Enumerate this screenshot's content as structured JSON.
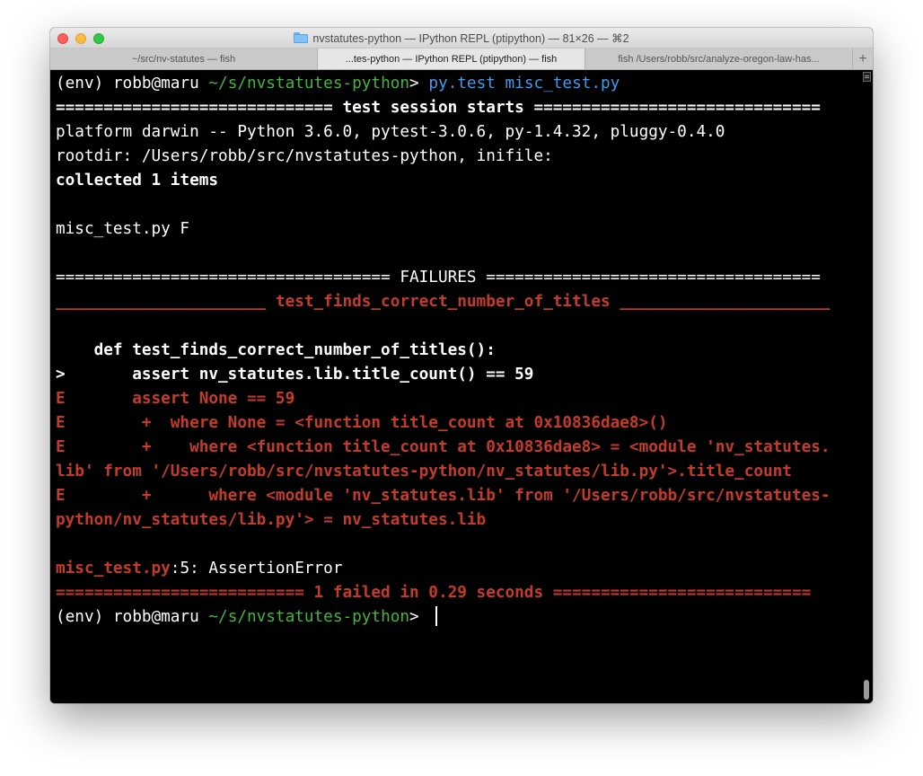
{
  "window": {
    "title": "nvstatutes-python — IPython REPL (ptipython) — 81×26 — ⌘2"
  },
  "tabs": [
    {
      "label": "~/src/nv-statutes — fish",
      "active": false
    },
    {
      "label": "...tes-python — IPython REPL (ptipython) — fish",
      "active": true
    },
    {
      "label": "fish  /Users/robb/src/analyze-oregon-law-has...",
      "active": false
    }
  ],
  "new_tab_label": "+",
  "colors": {
    "error_red": "#c53b2b",
    "prompt_green": "#44b53a",
    "command_blue": "#3d9bf0"
  },
  "terminal": {
    "prompt_env": "(env) robb@maru ",
    "prompt_dir": "~/s/nvstatutes-python",
    "prompt_gt": "> ",
    "command_1": "py.test",
    "command_2": "misc_test.py",
    "session_line": "============================= test session starts ==============================",
    "platform_line": "platform darwin -- Python 3.6.0, pytest-3.0.6, py-1.4.32, pluggy-0.4.0",
    "rootdir_line": "rootdir: /Users/robb/src/nvstatutes-python, inifile:",
    "collected_line": "collected 1 items",
    "progress_line": "misc_test.py F",
    "failures_line": "=================================== FAILURES ===================================",
    "test_header_line": "______________________ test_finds_correct_number_of_titles ______________________",
    "def_line": "    def test_finds_correct_number_of_titles():",
    "assert_line": ">       assert nv_statutes.lib.title_count() == 59",
    "err_line_1": "E       assert None == 59",
    "err_line_2": "E        +  where None = <function title_count at 0x10836dae8>()",
    "err_line_3": "E        +    where <function title_count at 0x10836dae8> = <module 'nv_statutes.",
    "err_line_4": "lib' from '/Users/robb/src/nvstatutes-python/nv_statutes/lib.py'>.title_count",
    "err_line_5": "E        +      where <module 'nv_statutes.lib' from '/Users/robb/src/nvstatutes-",
    "err_line_6": "python/nv_statutes/lib.py'> = nv_statutes.lib",
    "location_file": "misc_test.py",
    "location_rest": ":5: AssertionError",
    "summary_line": "========================== 1 failed in 0.29 seconds ==========================="
  }
}
